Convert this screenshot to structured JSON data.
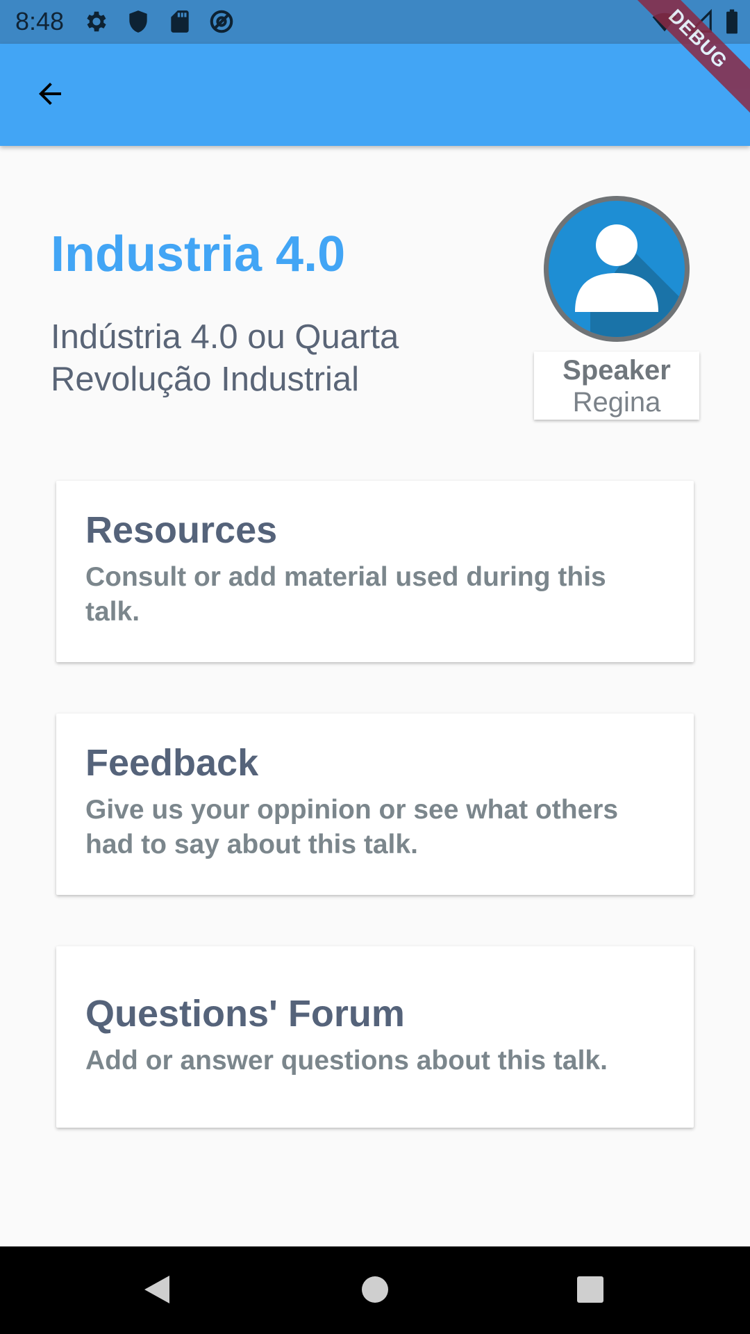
{
  "status_bar": {
    "time": "8:48",
    "left_icons": [
      "gear-icon",
      "shield-icon",
      "sd-card-icon",
      "at-icon"
    ],
    "right_icons": [
      "wifi-icon",
      "signal-icon",
      "battery-icon"
    ]
  },
  "app_bar": {
    "back_icon": "arrow-back-icon",
    "color": "#42a5f5"
  },
  "debug_banner": {
    "label": "DEBUG"
  },
  "talk": {
    "title": "Industria 4.0",
    "subtitle": "Indústria 4.0 ou Quarta Revolução Industrial"
  },
  "speaker": {
    "label": "Speaker",
    "name": "Regina",
    "avatar_icon": "person-icon"
  },
  "cards": [
    {
      "title": "Resources",
      "description": "Consult or add material used during this talk."
    },
    {
      "title": "Feedback",
      "description": "Give us your oppinion or see what others had to say about this talk."
    },
    {
      "title": "Questions' Forum",
      "description": "Add or answer questions about this talk."
    }
  ],
  "nav_bar": {
    "buttons": [
      "back-triangle-icon",
      "home-circle-icon",
      "recents-square-icon"
    ]
  }
}
